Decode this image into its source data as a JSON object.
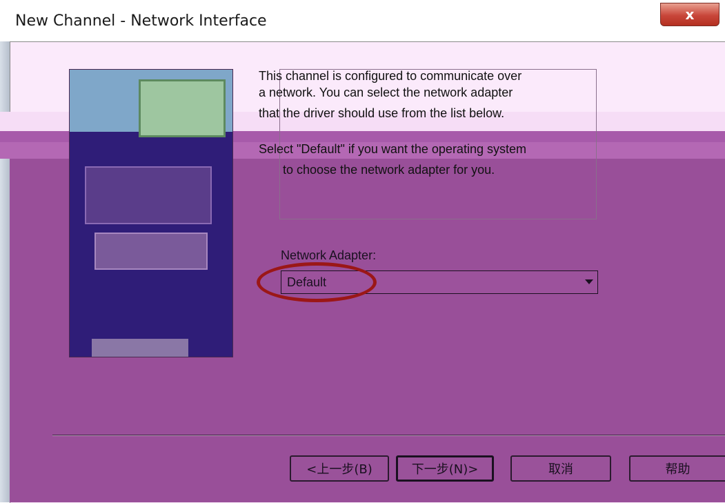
{
  "window": {
    "title": "New Channel - Network Interface",
    "close_label": "x"
  },
  "description": {
    "lines": [
      "This channel is configured to communicate over",
      "a network.  You can select the network adapter",
      "that the driver should use from the list below.",
      "Select \"Default\" if you want the operating system",
      "to choose the network adapter for you."
    ]
  },
  "network_adapter": {
    "label": "Network Adapter:",
    "value": "Default"
  },
  "buttons": {
    "back": "<上一步(B)",
    "next": "下一步(N)>",
    "cancel": "取消",
    "help": "帮助"
  },
  "colors": {
    "tint": "#994f99",
    "highlight": "#9b1717",
    "close_button": "#c8463a"
  }
}
